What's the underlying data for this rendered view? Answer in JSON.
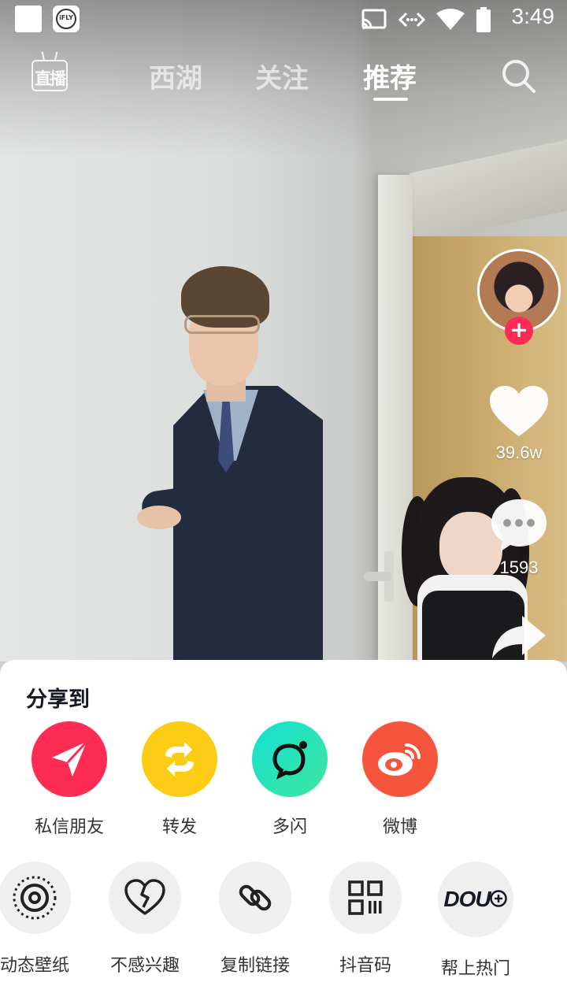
{
  "status_bar": {
    "time": "3:49",
    "app_badge": "iFLY",
    "icons": [
      "cast-icon",
      "data-transfer-icon",
      "wifi-icon",
      "battery-icon"
    ]
  },
  "top_nav": {
    "live_label": "直播",
    "tabs": [
      {
        "label": "西湖",
        "active": false
      },
      {
        "label": "关注",
        "active": false
      },
      {
        "label": "推荐",
        "active": true
      }
    ]
  },
  "actions": {
    "likes": "39.6w",
    "comments": "1593"
  },
  "share_sheet": {
    "title": "分享到",
    "share_targets": [
      {
        "label": "私信朋友",
        "icon": "paper-plane-icon",
        "color": "#fe2c55"
      },
      {
        "label": "转发",
        "icon": "repost-icon",
        "color": "#fdcc15"
      },
      {
        "label": "多闪",
        "icon": "duoshan-icon",
        "color": "#2ee0c6"
      },
      {
        "label": "微博",
        "icon": "weibo-icon",
        "color": "#f5553c"
      }
    ],
    "more_actions": [
      {
        "label": "动态壁纸",
        "icon": "live-wallpaper-icon"
      },
      {
        "label": "不感兴趣",
        "icon": "broken-heart-icon"
      },
      {
        "label": "复制链接",
        "icon": "link-icon"
      },
      {
        "label": "抖音码",
        "icon": "qr-code-icon"
      },
      {
        "label": "帮上热门",
        "icon": "dou-plus-icon",
        "logo_text": "DOU"
      }
    ]
  },
  "colors": {
    "accent": "#fe2c55",
    "sheet_bg": "#ffffff",
    "action_bg": "#efefef"
  }
}
